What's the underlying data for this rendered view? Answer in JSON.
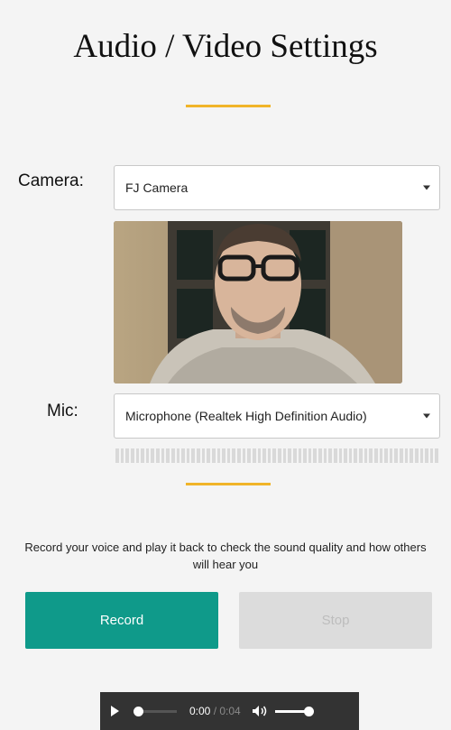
{
  "header": {
    "title": "Audio / Video Settings"
  },
  "camera": {
    "label": "Camera:",
    "selected": "FJ Camera"
  },
  "mic": {
    "label": "Mic:",
    "selected": "Microphone (Realtek High Definition Audio)"
  },
  "instructions": "Record your voice and play it back to check the sound quality and how others will hear you",
  "buttons": {
    "record": "Record",
    "stop": "Stop"
  },
  "player": {
    "current_time": "0:00",
    "separator": " / ",
    "duration": "0:04"
  },
  "colors": {
    "accent_divider": "#f0b429",
    "record_button": "#0f9a8a",
    "stop_button": "#dcdcdc",
    "player_bg": "#333333"
  },
  "icons": {
    "play": "play-icon",
    "volume": "volume-icon",
    "dropdown": "chevron-down-icon"
  }
}
